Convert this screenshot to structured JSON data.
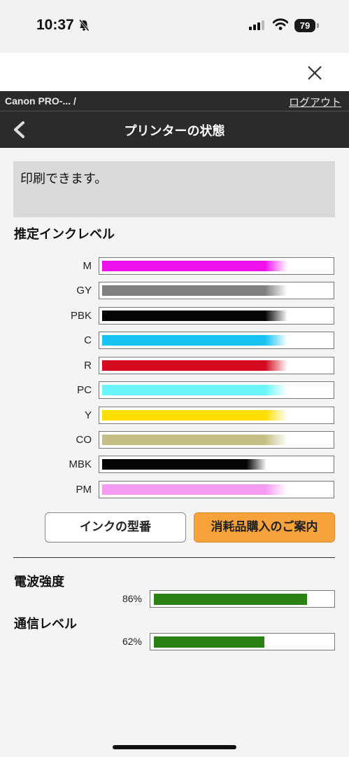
{
  "status_bar": {
    "time": "10:37",
    "battery": "79"
  },
  "breadcrumb": {
    "text": "Canon PRO-... /",
    "logout_label": "ログアウト"
  },
  "header": {
    "title": "プリンターの状態"
  },
  "status_message": "印刷できます。",
  "ink_section": {
    "heading": "推定インクレベル",
    "inks": [
      {
        "label": "M",
        "level": 0.81,
        "color": "#ee11ee"
      },
      {
        "label": "GY",
        "level": 0.81,
        "color": "#808080"
      },
      {
        "label": "PBK",
        "level": 0.81,
        "color": "#050505"
      },
      {
        "label": "C",
        "level": 0.81,
        "color": "#16c3f2"
      },
      {
        "label": "R",
        "level": 0.81,
        "color": "#d40a1e"
      },
      {
        "label": "PC",
        "level": 0.81,
        "color": "#6af6fa"
      },
      {
        "label": "Y",
        "level": 0.81,
        "color": "#ffde00"
      },
      {
        "label": "CO",
        "level": 0.81,
        "color": "#c6bf85"
      },
      {
        "label": "MBK",
        "level": 0.72,
        "color": "#050505"
      },
      {
        "label": "PM",
        "level": 0.81,
        "color": "#f59bf2"
      }
    ]
  },
  "buttons": {
    "ink_model": "インクの型番",
    "purchase": "消耗品購入のご案内"
  },
  "signal": {
    "heading": "電波強度",
    "percent_label": "86%",
    "value": 0.86
  },
  "comm": {
    "heading": "通信レベル",
    "percent_label": "62%",
    "value": 0.62
  },
  "colors": {
    "accent": "#f7a23b",
    "level_bar": "#2a8010",
    "header_bg": "#2b2b2b"
  }
}
